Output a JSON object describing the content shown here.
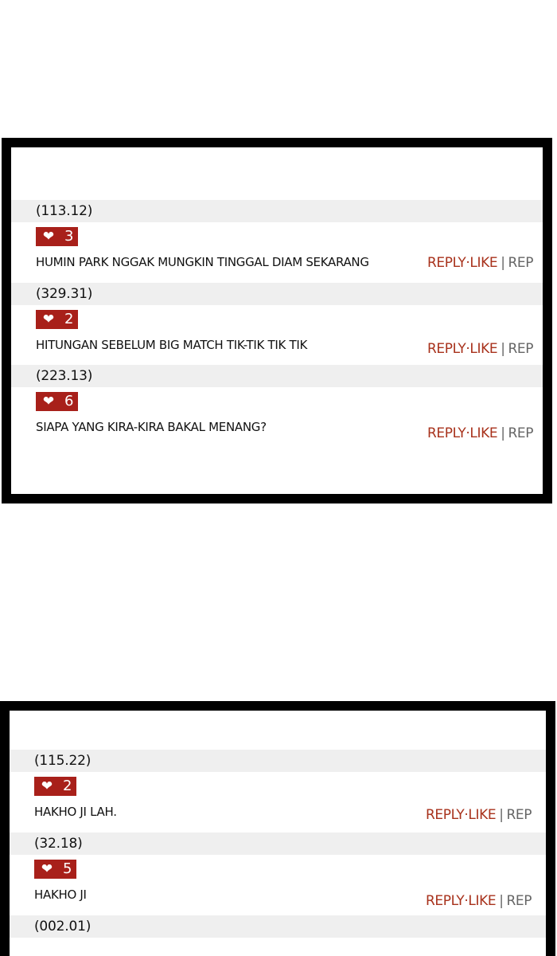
{
  "panels": [
    {
      "comments": [
        {
          "id": "(113.12)",
          "likes": "3",
          "text": "HUMIN PARK NGGAK MUNGKIN TINGGAL DIAM SEKARANG",
          "reply_like": "REPLY·LIKE",
          "separator": "|",
          "rep_cut": "REP"
        },
        {
          "id": "(329.31)",
          "likes": "2",
          "text": "HITUNGAN SEBELUM BIG MATCH TIK-TIK TIK TIK",
          "reply_like": "REPLY·LIKE",
          "separator": "|",
          "rep_cut": "REP"
        },
        {
          "id": "(223.13)",
          "likes": "6",
          "text": "SIAPA YANG KIRA-KIRA BAKAL MENANG?",
          "reply_like": "REPLY·LIKE",
          "separator": "|",
          "rep_cut": "REP"
        }
      ]
    },
    {
      "comments": [
        {
          "id": "(115.22)",
          "likes": "2",
          "text": "HAKHO JI LAH.",
          "reply_like": "REPLY·LIKE",
          "separator": "|",
          "rep_cut": "REP"
        },
        {
          "id": "(32.18)",
          "likes": "5",
          "text": "HAKHO JI",
          "reply_like": "REPLY·LIKE",
          "separator": "|",
          "rep_cut": "REP"
        },
        {
          "id": "(002.01)"
        }
      ]
    }
  ],
  "icons": {
    "like": "heart-icon"
  },
  "colors": {
    "accent": "#a8201a",
    "reply_like_text": "#a8321c",
    "row_background": "#efefef",
    "panel_border": "#000000"
  }
}
